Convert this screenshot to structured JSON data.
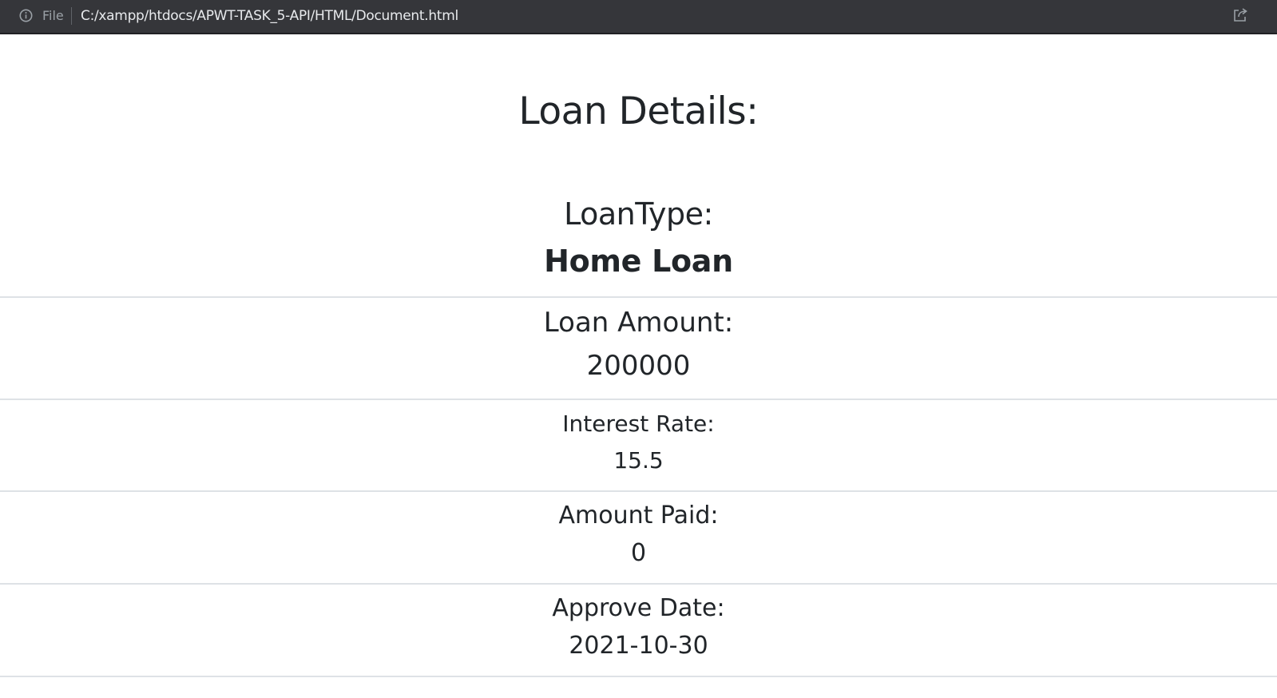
{
  "browser": {
    "scheme_label": "File",
    "url": "C:/xampp/htdocs/APWT-TASK_5-API/HTML/Document.html",
    "icons": {
      "info": "info-icon",
      "share": "share-icon"
    }
  },
  "page": {
    "title": "Loan Details:",
    "loan_type": {
      "label": "LoanType:",
      "value": "Home Loan"
    },
    "fields": [
      {
        "label": "Loan Amount:",
        "value": "200000"
      },
      {
        "label": "Interest Rate:",
        "value": "15.5"
      },
      {
        "label": "Amount Paid:",
        "value": "0"
      },
      {
        "label": "Approve Date:",
        "value": "2021-10-30"
      }
    ]
  }
}
